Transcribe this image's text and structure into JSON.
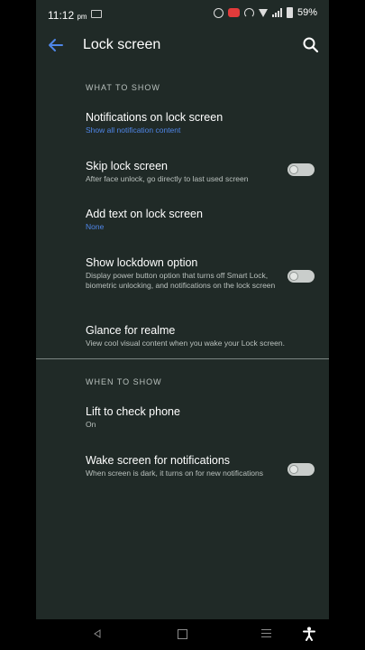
{
  "status_bar": {
    "time": "11:12",
    "ampm": "pm",
    "battery": "59%"
  },
  "app_bar": {
    "title": "Lock screen"
  },
  "sections": {
    "what": {
      "header": "WHAT TO SHOW"
    },
    "when": {
      "header": "WHEN TO SHOW"
    }
  },
  "items": {
    "notifications": {
      "title": "Notifications on lock screen",
      "subtitle": "Show all notification content"
    },
    "skip": {
      "title": "Skip lock screen",
      "subtitle": "After face unlock, go directly to last used screen",
      "enabled": false
    },
    "add_text": {
      "title": "Add text on lock screen",
      "subtitle": "None"
    },
    "lockdown": {
      "title": "Show lockdown option",
      "subtitle": "Display power button option that turns off Smart Lock, biometric unlocking, and notifications on the lock screen",
      "enabled": false
    },
    "glance": {
      "title": "Glance for realme",
      "subtitle": "View cool visual content when you wake your Lock screen."
    },
    "lift": {
      "title": "Lift to check phone",
      "subtitle": "On"
    },
    "wake": {
      "title": "Wake screen for notifications",
      "subtitle": "When screen is dark, it turns on for new notifications",
      "enabled": false
    }
  },
  "colors": {
    "background": "#202a27",
    "accent": "#4f86e8",
    "toggle_off": "#c9cdcb"
  },
  "icons": {
    "back": "arrow-left-icon",
    "search": "search-icon",
    "nav_back": "triangle-back-icon",
    "nav_home": "square-home-icon",
    "nav_menu": "menu-lines-icon",
    "accessibility": "accessibility-person-icon"
  }
}
